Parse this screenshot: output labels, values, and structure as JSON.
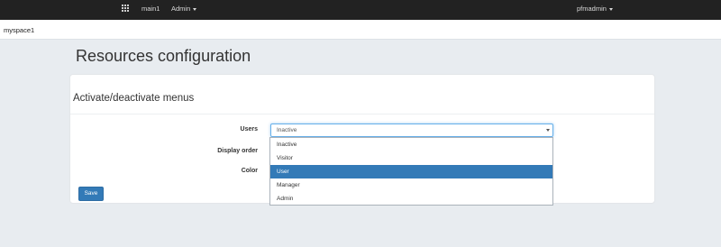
{
  "topbar": {
    "apps_icon": "grid-icon",
    "workspace_link": "main1",
    "admin_menu": "Admin",
    "user_menu": "pfmadmin"
  },
  "subbar": {
    "space_name": "myspace1"
  },
  "page": {
    "title": "Resources configuration"
  },
  "panel": {
    "heading": "Activate/deactivate menus",
    "fields": {
      "users_label": "Users",
      "display_order_label": "Display order",
      "color_label": "Color"
    },
    "users_select": {
      "value": "Inactive",
      "options": [
        "Inactive",
        "Visitor",
        "User",
        "Manager",
        "Admin"
      ],
      "highlighted": "User"
    },
    "save_label": "Save"
  },
  "colors": {
    "topbar_bg": "#222222",
    "accent": "#337ab7",
    "page_bg": "#e8ecf0"
  }
}
